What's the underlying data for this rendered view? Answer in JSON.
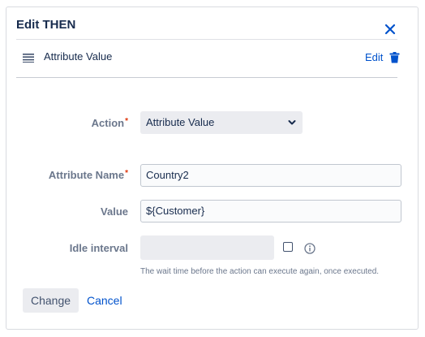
{
  "dialog": {
    "title": "Edit THEN",
    "close_icon": "close-icon"
  },
  "rule": {
    "name": "Attribute Value",
    "edit_label": "Edit",
    "drag_icon": "drag-handle-icon",
    "delete_icon": "trash-icon"
  },
  "form": {
    "action": {
      "label": "Action",
      "value": "Attribute Value",
      "required": "*"
    },
    "attribute_name": {
      "label": "Attribute Name",
      "value": "Country2",
      "required": "*"
    },
    "value": {
      "label": "Value",
      "value": "${Customer}"
    },
    "idle_interval": {
      "label": "Idle interval",
      "value": "",
      "checked": false,
      "help": "The wait time before the action can execute again, once executed."
    }
  },
  "buttons": {
    "change_label": "Change",
    "cancel_label": "Cancel"
  },
  "colors": {
    "accent": "#0052cc",
    "required": "#de350b",
    "label": "#6b778c"
  }
}
